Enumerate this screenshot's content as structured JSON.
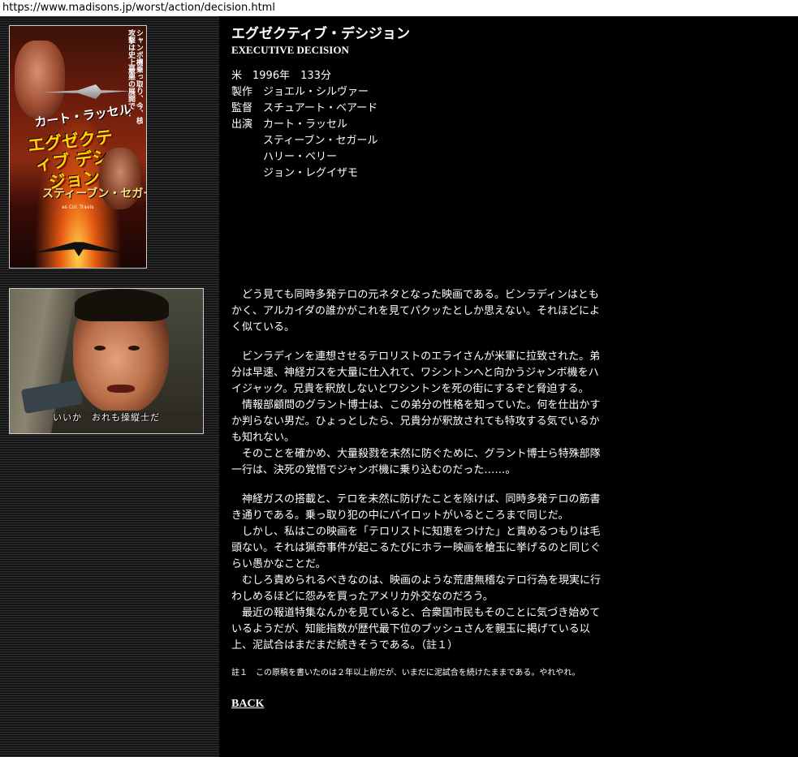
{
  "browser": {
    "url": "https://www.madisons.jp/worst/action/decision.html"
  },
  "poster": {
    "vertical_text": "シャンボ機乗っ取り、今、核攻撃は史上最悪の展開で…",
    "top_line": "カート・ラッセル",
    "title": "エグゼクティブ デシジョン",
    "star": "スティーブン・セガール",
    "sub": "as Col. Travis"
  },
  "still": {
    "caption": "いいか　おれも操縦士だ"
  },
  "movie": {
    "title_ja": "エグゼクティブ・デシジョン",
    "title_en": "EXECUTIVE DECISION",
    "meta": "米　1996年　133分",
    "credits": [
      {
        "label": "製作",
        "value": "ジョエル・シルヴァー"
      },
      {
        "label": "監督",
        "value": "スチュアート・ベアード"
      },
      {
        "label": "出演",
        "value": "カート・ラッセル"
      },
      {
        "label": "",
        "value": "スティーブン・セガール"
      },
      {
        "label": "",
        "value": "ハリー・ベリー"
      },
      {
        "label": "",
        "value": "ジョン・レグイザモ"
      }
    ]
  },
  "review": {
    "paragraph1": "どう見ても同時多発テロの元ネタとなった映画である。ビンラディンはともかく、アルカイダの誰かがこれを見てパクッたとしか思えない。それほどによく似ている。",
    "paragraph2a": "ビンラディンを連想させるテロリストのエライさんが米軍に拉致された。弟分は早速、神経ガスを大量に仕入れて、ワシントンへと向かうジャンボ機をハイジャック。兄貴を釈放しないとワシントンを死の街にするぞと脅迫する。",
    "paragraph2b": "情報部顧問のグラント博士は、この弟分の性格を知っていた。何を仕出かすか判らない男だ。ひょっとしたら、兄貴分が釈放されても特攻する気でいるかも知れない。",
    "paragraph2c": "そのことを確かめ、大量殺戮を未然に防ぐために、グラント博士ら特殊部隊一行は、決死の覚悟でジャンボ機に乗り込むのだった……。",
    "paragraph3a": "神経ガスの搭載と、テロを未然に防げたことを除けば、同時多発テロの筋書き通りである。乗っ取り犯の中にパイロットがいるところまで同じだ。",
    "paragraph3b": "しかし、私はこの映画を「テロリストに知恵をつけた」と責めるつもりは毛頭ない。それは猟奇事件が起こるたびにホラー映画を槍玉に挙げるのと同じぐらい愚かなことだ。",
    "paragraph3c": "むしろ責められるべきなのは、映画のような荒唐無稽なテロ行為を現実に行わしめるほどに怨みを買ったアメリカ外交なのだろう。",
    "paragraph3d": "最近の報道特集なんかを見ていると、合衆国市民もそのことに気づき始めているようだが、知能指数が歴代最下位のブッシュさんを親玉に掲げている以上、泥試合はまだまだ続きそうである。（註１）"
  },
  "footnote": "註１　この原稿を書いたのは２年以上前だが、いまだに泥試合を続けたままである。やれやれ。",
  "nav": {
    "back_label": "BACK"
  }
}
